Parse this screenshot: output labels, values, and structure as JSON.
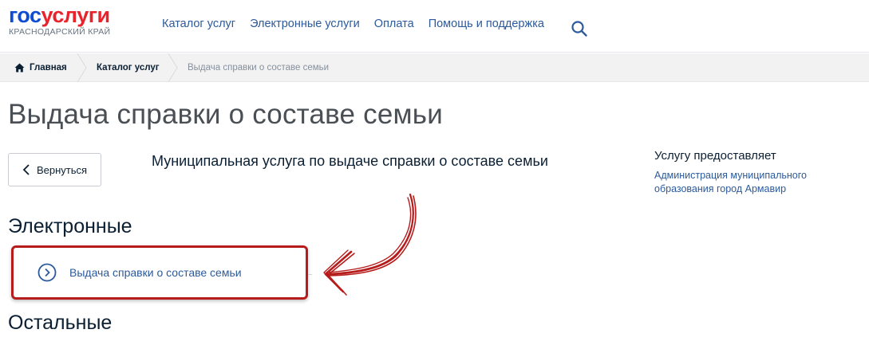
{
  "header": {
    "logo_gos": "гос",
    "logo_uslugi": "услуги",
    "logo_region": "КРАСНОДАРСКИЙ КРАЙ",
    "nav": [
      "Каталог услуг",
      "Электронные услуги",
      "Оплата",
      "Помощь и поддержка"
    ],
    "search_icon": "search-icon"
  },
  "breadcrumbs": {
    "home": "Главная",
    "catalog": "Каталог услуг",
    "current": "Выдача справки о составе семьи"
  },
  "page": {
    "title": "Выдача справки о составе семьи",
    "back_label": "Вернуться",
    "description": "Муниципальная услуга по выдаче справки о составе семьи"
  },
  "provider": {
    "title": "Услугу предоставляет",
    "link": "Администрация муниципального образования город Армавир"
  },
  "sections": {
    "electronic": "Электронные",
    "electronic_item": "Выдача справки о составе семьи",
    "other": "Остальные"
  },
  "colors": {
    "accent_blue": "#0d4cd3",
    "logo_red": "#e9232c",
    "link": "#2c5a9b",
    "highlight_red": "#b71c1c"
  }
}
